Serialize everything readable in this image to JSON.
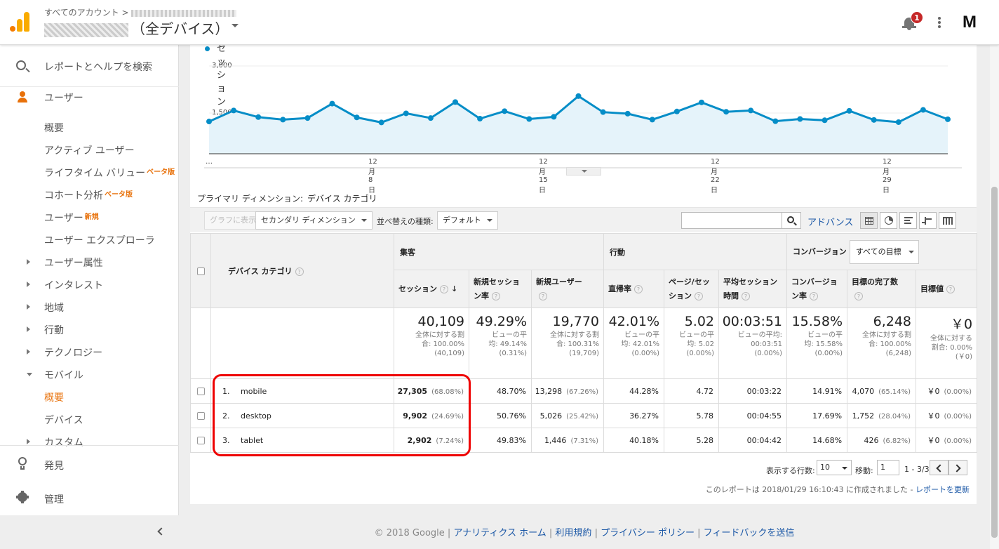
{
  "header": {
    "breadcrumb": "すべてのアカウント >",
    "view_name": "（全デバイス）",
    "notification_count": "1",
    "avatar_letter": "M"
  },
  "sidebar": {
    "search_label": "レポートとヘルプを検索",
    "section_label": "ユーザー",
    "items": [
      {
        "label": "概要",
        "badge": "",
        "arrow": ""
      },
      {
        "label": "アクティブ ユーザー",
        "badge": "",
        "arrow": ""
      },
      {
        "label": "ライフタイム バリュー",
        "badge": "ベータ版",
        "arrow": ""
      },
      {
        "label": "コホート分析",
        "badge": "ベータ版",
        "arrow": ""
      },
      {
        "label": "ユーザー",
        "badge": "新規",
        "arrow": ""
      },
      {
        "label": "ユーザー エクスプローラ",
        "badge": "",
        "arrow": ""
      },
      {
        "label": "ユーザー属性",
        "badge": "",
        "arrow": "right"
      },
      {
        "label": "インタレスト",
        "badge": "",
        "arrow": "right"
      },
      {
        "label": "地域",
        "badge": "",
        "arrow": "right"
      },
      {
        "label": "行動",
        "badge": "",
        "arrow": "right"
      },
      {
        "label": "テクノロジー",
        "badge": "",
        "arrow": "right"
      },
      {
        "label": "モバイル",
        "badge": "",
        "arrow": "down"
      },
      {
        "label": "概要",
        "badge": "",
        "arrow": "",
        "active": true
      },
      {
        "label": "デバイス",
        "badge": "",
        "arrow": ""
      },
      {
        "label": "カスタム",
        "badge": "",
        "arrow": "right"
      }
    ],
    "discover_label": "発見",
    "admin_label": "管理"
  },
  "chart_data": {
    "type": "area",
    "series": [
      {
        "name": "セッション",
        "values": [
          1230,
          1580,
          1370,
          1290,
          1340,
          1800,
          1360,
          1200,
          1490,
          1340,
          1850,
          1320,
          1560,
          1310,
          1380,
          2040,
          1530,
          1480,
          1290,
          1550,
          1840,
          1540,
          1580,
          1240,
          1310,
          1270,
          1570,
          1280,
          1210,
          1600,
          1300
        ]
      }
    ],
    "x_ticks": [
      "…",
      "12月8日",
      "12月15日",
      "12月22日",
      "12月29日"
    ],
    "y_ticks": [
      "3,000",
      "1,500"
    ],
    "ylim": [
      0,
      3000
    ],
    "color": "#058dc7",
    "fill": "#e5f3fa"
  },
  "primary_dimension": {
    "label": "プライマリ ディメンション:",
    "value": "デバイス カテゴリ"
  },
  "toolbar": {
    "graph_button": "グラフに表示",
    "secondary_dimension": "セカンダリ ディメンション",
    "sort_label": "並べ替えの種類:",
    "sort_value": "デフォルト",
    "search_value": "",
    "advanced": "アドバンス"
  },
  "table": {
    "dimension_header": "デバイス カテゴリ",
    "group_acquisition": "集客",
    "group_behavior": "行動",
    "group_conversion": "コンバージョン",
    "goal_select": "すべての目標",
    "columns": [
      {
        "l1": "セッション",
        "l2": ""
      },
      {
        "l1": "新規セッショ",
        "l2": "ン率"
      },
      {
        "l1": "新規ユーザー",
        "l2": ""
      },
      {
        "l1": "直帰率",
        "l2": ""
      },
      {
        "l1": "ページ/セッ",
        "l2": "ション"
      },
      {
        "l1": "平均セッション",
        "l2": "時間"
      },
      {
        "l1": "コンバージョ",
        "l2": "ン率"
      },
      {
        "l1": "目標の完了数",
        "l2": ""
      },
      {
        "l1": "目標値",
        "l2": ""
      }
    ],
    "totals": [
      {
        "big": "40,109",
        "s1": "全体に対する割",
        "s2": "合: 100.00%",
        "s3": "(40,109)"
      },
      {
        "big": "49.29%",
        "s1": "ビューの平",
        "s2": "均: 49.14%",
        "s3": "(0.31%)"
      },
      {
        "big": "19,770",
        "s1": "全体に対する割",
        "s2": "合: 100.31%",
        "s3": "(19,709)"
      },
      {
        "big": "42.01%",
        "s1": "ビューの平",
        "s2": "均: 42.01%",
        "s3": "(0.00%)"
      },
      {
        "big": "5.02",
        "s1": "ビューの平",
        "s2": "均: 5.02",
        "s3": "(0.00%)"
      },
      {
        "big": "00:03:51",
        "s1": "ビューの平均:",
        "s2": "00:03:51",
        "s3": "(0.00%)"
      },
      {
        "big": "15.58%",
        "s1": "ビューの平",
        "s2": "均: 15.58%",
        "s3": "(0.00%)"
      },
      {
        "big": "6,248",
        "s1": "全体に対する割",
        "s2": "合: 100.00%",
        "s3": "(6,248)"
      },
      {
        "big": "￥0",
        "s1": "全体に対する",
        "s2": "割合: 0.00%",
        "s3": "(￥0)"
      }
    ],
    "rows": [
      {
        "idx": "1.",
        "name": "mobile",
        "sessions": "27,305",
        "sessions_pct": "(68.08%)",
        "new_session_rate": "48.70%",
        "new_users": "13,298",
        "new_users_pct": "(67.26%)",
        "bounce": "44.28%",
        "pages": "4.72",
        "duration": "00:03:22",
        "cvr": "14.91%",
        "goals": "4,070",
        "goals_pct": "(65.14%)",
        "value": "￥0",
        "value_pct": "(0.00%)"
      },
      {
        "idx": "2.",
        "name": "desktop",
        "sessions": "9,902",
        "sessions_pct": "(24.69%)",
        "new_session_rate": "50.76%",
        "new_users": "5,026",
        "new_users_pct": "(25.42%)",
        "bounce": "36.27%",
        "pages": "5.78",
        "duration": "00:04:55",
        "cvr": "17.69%",
        "goals": "1,752",
        "goals_pct": "(28.04%)",
        "value": "￥0",
        "value_pct": "(0.00%)"
      },
      {
        "idx": "3.",
        "name": "tablet",
        "sessions": "2,902",
        "sessions_pct": "(7.24%)",
        "new_session_rate": "49.83%",
        "new_users": "1,446",
        "new_users_pct": "(7.31%)",
        "bounce": "40.18%",
        "pages": "5.28",
        "duration": "00:04:42",
        "cvr": "14.68%",
        "goals": "426",
        "goals_pct": "(6.82%)",
        "value": "￥0",
        "value_pct": "(0.00%)"
      }
    ]
  },
  "pager": {
    "rows_label": "表示する行数:",
    "rows_value": "10",
    "goto_label": "移動:",
    "goto_value": "1",
    "range": "1 - 3/3"
  },
  "report_time": {
    "text": "このレポートは 2018/01/29 16:10:43 に作成されました -",
    "refresh": "レポートを更新"
  },
  "footer": {
    "copyright": "© 2018 Google |",
    "home": "アナリティクス ホーム",
    "terms": "利用規約",
    "privacy": "プライバシー ポリシー",
    "feedback": "フィードバックを送信",
    "sep": "|"
  }
}
